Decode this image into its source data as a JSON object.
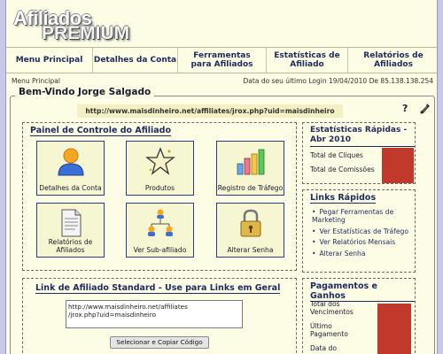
{
  "logo": {
    "line1": "Afiliados",
    "line2": "PREMIUM"
  },
  "nav": [
    {
      "label": "Menu Principal"
    },
    {
      "label": "Detalhes da Conta"
    },
    {
      "label": "Ferramentas para Afiliados"
    },
    {
      "label": "Estatísticas de Afiliado"
    },
    {
      "label": "Relatórios de Afiliados"
    }
  ],
  "status": {
    "breadcrumb": "Menu Principal",
    "last_login": "Data do seu último Login 19/04/2010 De 85.138.138.254"
  },
  "welcome": {
    "title": "Bem-Vindo Jorge Salgado",
    "url": "http://www.maisdinheiro.net/affiliates/jrox.php?uid=maisdinheiro",
    "help_symbol": "?"
  },
  "control_panel": {
    "title": "Painel de Controle do Afiliado",
    "tiles": [
      {
        "label": "Detalhes da Conta",
        "icon": "user-icon"
      },
      {
        "label": "Produtos",
        "icon": "star-icon"
      },
      {
        "label": "Registro de Tráfego",
        "icon": "bar-chart-icon"
      },
      {
        "label": "Relatórios de Afiliados",
        "icon": "document-icon"
      },
      {
        "label": "Ver Sub-afiliado",
        "icon": "network-icon"
      },
      {
        "label": "Alterar Senha",
        "icon": "padlock-icon"
      }
    ]
  },
  "quick_stats": {
    "title": "Estatísticas Rápidas - Abr 2010",
    "rows": [
      "Total de Cliques",
      "Total de Comissões"
    ]
  },
  "quick_links": {
    "title": "Links Rápidos",
    "items": [
      "Pegar Ferramentas de Marketing",
      "Ver Estatísticas de Tráfego",
      "Ver Relatórios Mensais",
      "Alterar Senha"
    ]
  },
  "payments": {
    "title": "Pagamentos e Ganhos",
    "rows": [
      "Total dos Vencimentos",
      "Último Pagamento",
      "Data do"
    ]
  },
  "affiliate_link": {
    "title": "Link de Afiliado Standard - Use para Links em Geral",
    "value": "http://www.maisdinheiro.net/affiliates\n/jrox.php?uid=maisdinheiro",
    "button": "Selecionar e Copiar Código"
  },
  "colors": {
    "accent": "#1d2a5e",
    "bar": "#c0392b",
    "page_bg": "#fdfde6",
    "body_bg": "#c8c8e8"
  }
}
